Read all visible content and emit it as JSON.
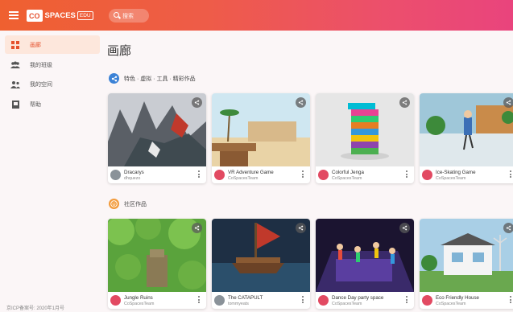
{
  "app": {
    "logo_co": "CO",
    "logo_name": "SPACES",
    "logo_badge": "EDU",
    "search_placeholder": "搜索"
  },
  "sidebar": {
    "items": [
      {
        "label": "画廊",
        "icon": "grid-icon",
        "active": true
      },
      {
        "label": "我的班级",
        "icon": "group-icon",
        "active": false
      },
      {
        "label": "我的空间",
        "icon": "people-icon",
        "active": false
      },
      {
        "label": "帮助",
        "icon": "book-icon",
        "active": false
      }
    ],
    "footer": "京ICP备案号: 2020年1月号"
  },
  "main": {
    "title": "画廊",
    "sections": [
      {
        "label": "特色 · 虚拟 · 工具 · 精彩作品",
        "cards": [
          {
            "title": "Dracarys",
            "author": "dhquezo"
          },
          {
            "title": "VR Adventure Game",
            "author": "CoSpacesTeam"
          },
          {
            "title": "Colorful Jenga",
            "author": "CoSpacesTeam"
          },
          {
            "title": "Ice-Skating Game",
            "author": "CoSpacesTeam"
          }
        ]
      },
      {
        "label": "社区作品",
        "cards": [
          {
            "title": "Jungle Ruins",
            "author": "CoSpacesTeam"
          },
          {
            "title": "The CATAPULT",
            "author": "tommyeats"
          },
          {
            "title": "Dance Day party space",
            "author": "CoSpacesTeam"
          },
          {
            "title": "Eco Friendly House",
            "author": "CoSpacesTeam"
          }
        ]
      }
    ]
  },
  "colors": {
    "accent": "#e5502c",
    "share_icon_bg": "#5a5a5a",
    "section1_icon": "#3b82d6",
    "section2_icon": "#f29a3a"
  }
}
